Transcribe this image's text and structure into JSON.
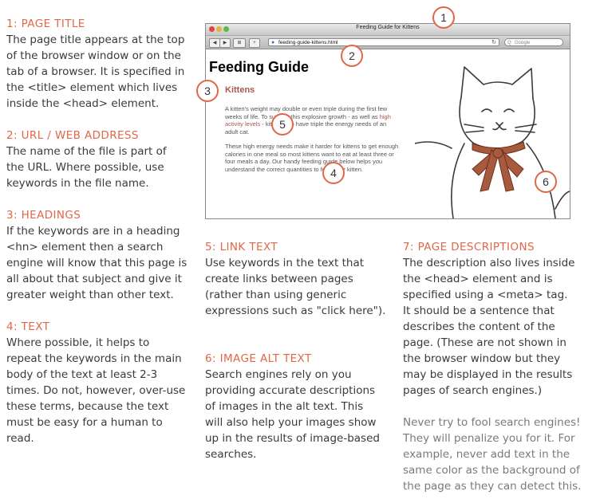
{
  "left_column": {
    "sections": [
      {
        "heading": "1: PAGE TITLE",
        "lines": [
          "The page title appears at the top",
          "of the browser window or on the",
          "tab of a browser. It is specified in",
          "the <title> element which lives",
          "inside the <head> element."
        ]
      },
      {
        "heading": "2: URL / WEB ADDRESS",
        "lines": [
          "The name of the file is part of",
          "the URL. Where possible, use",
          "keywords in the file name."
        ]
      },
      {
        "heading": "3: HEADINGS",
        "lines": [
          "If the keywords are in a heading",
          "<hn> element then a search",
          "engine will know that this page is",
          "all about that subject and give it",
          "greater weight than other text."
        ]
      },
      {
        "heading": "4: TEXT",
        "lines": [
          "Where possible, it helps to",
          "repeat the keywords in the main",
          "body of the text at least 2-3",
          "times. Do not, however, over-use",
          "these terms, because the text",
          "must be easy for a human to",
          "read."
        ]
      }
    ]
  },
  "middle_column": {
    "sections": [
      {
        "heading": "5: LINK TEXT",
        "lines": [
          "Use keywords in the text that",
          "create links between pages",
          "(rather than using generic",
          "expressions such as \"click here\")."
        ]
      },
      {
        "heading": "6: IMAGE ALT TEXT",
        "lines": [
          "Search engines rely on you",
          "providing accurate descriptions",
          "of images in the alt text. This",
          "will also help your images show",
          "up in the results of image-based",
          "searches."
        ]
      }
    ]
  },
  "right_column": {
    "heading": "7: PAGE DESCRIPTIONS",
    "lines": [
      "The description also lives inside",
      "the <head> element and is",
      "specified using a <meta> tag.",
      "It should be a sentence that",
      "describes the content of the",
      "page. (These are not shown in",
      "the browser window but they",
      "may be displayed in the results",
      "pages of search engines.)"
    ],
    "note_lines": [
      "Never try to fool search engines!",
      "They will penalize you for it. For",
      "example, never add text in the",
      "same color as the background of",
      "the page as they can detect this."
    ]
  },
  "browser": {
    "window_title": "Feeding Guide for Kittens",
    "url": "feeding-guide-kittens.html",
    "search_placeholder": "Google",
    "page_heading": "Feeding Guide",
    "page_subheading": "Kittens",
    "paragraph1_lines": [
      "A kitten's weight may double or even triple during the first few",
      "weeks of life. To support this explosive growth - as well as high",
      "activity levels - kittens can have triple the energy needs of an",
      "adult cat."
    ],
    "paragraph1_link": "high activity levels",
    "paragraph2_lines": [
      "These high energy needs make it harder for kittens to get enough",
      "calories in one meal so most kittens want to eat at least three or",
      "four meals a day. Our handy feeding guide below helps you",
      "understand the correct quantities to feed your kitten."
    ]
  },
  "callouts": [
    "1",
    "2",
    "3",
    "4",
    "5",
    "6"
  ],
  "colors": {
    "accent": "#e0674a",
    "body_text": "#3a3a3a",
    "note_text": "#7a7a7a",
    "subheading": "#a8584e"
  }
}
